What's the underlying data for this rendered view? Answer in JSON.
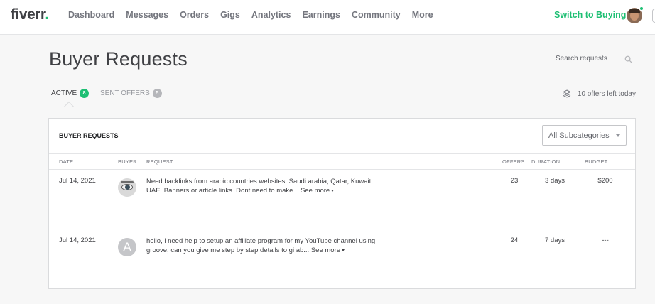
{
  "header": {
    "logo_text": "fiverr",
    "logo_dot": ".",
    "nav": [
      {
        "label": "Dashboard"
      },
      {
        "label": "Messages"
      },
      {
        "label": "Orders"
      },
      {
        "label": "Gigs"
      },
      {
        "label": "Analytics"
      },
      {
        "label": "Earnings"
      },
      {
        "label": "Community"
      },
      {
        "label": "More"
      }
    ],
    "switch_label": "Switch to Buying"
  },
  "page": {
    "title": "Buyer Requests",
    "search_placeholder": "Search requests"
  },
  "tabs": {
    "active": {
      "label": "ACTIVE",
      "count": "8"
    },
    "sent": {
      "label": "SENT OFFERS",
      "count": "5"
    },
    "offers_left": "10 offers left today"
  },
  "panel": {
    "title": "BUYER REQUESTS",
    "subcategory_selected": "All Subcategories",
    "columns": {
      "date": "DATE",
      "buyer": "BUYER",
      "request": "REQUEST",
      "offers": "OFFERS",
      "duration": "DURATION",
      "budget": "BUDGET"
    },
    "rows": [
      {
        "date": "Jul 14, 2021",
        "request": "Need backlinks from arabic countries websites. Saudi arabia, Qatar, Kuwait, UAE. Banners or article links. Dont need to make...",
        "see_more": "See more",
        "offers": "23",
        "duration": "3 days",
        "budget": "$200"
      },
      {
        "date": "Jul 14, 2021",
        "buyer_initial": "A",
        "request": "hello, i need help to setup an affiliate program for my YouTube channel using groove, can you give me step by step details to gi ab...",
        "see_more": "See more",
        "offers": "24",
        "duration": "7 days",
        "budget": "---"
      }
    ]
  },
  "colors": {
    "brand_green": "#1dbf73",
    "text_dark": "#404145",
    "text_muted": "#74767e",
    "background": "#f7f7f7"
  },
  "icons": [
    "search-icon",
    "stack-icon",
    "chevron-down-icon"
  ]
}
